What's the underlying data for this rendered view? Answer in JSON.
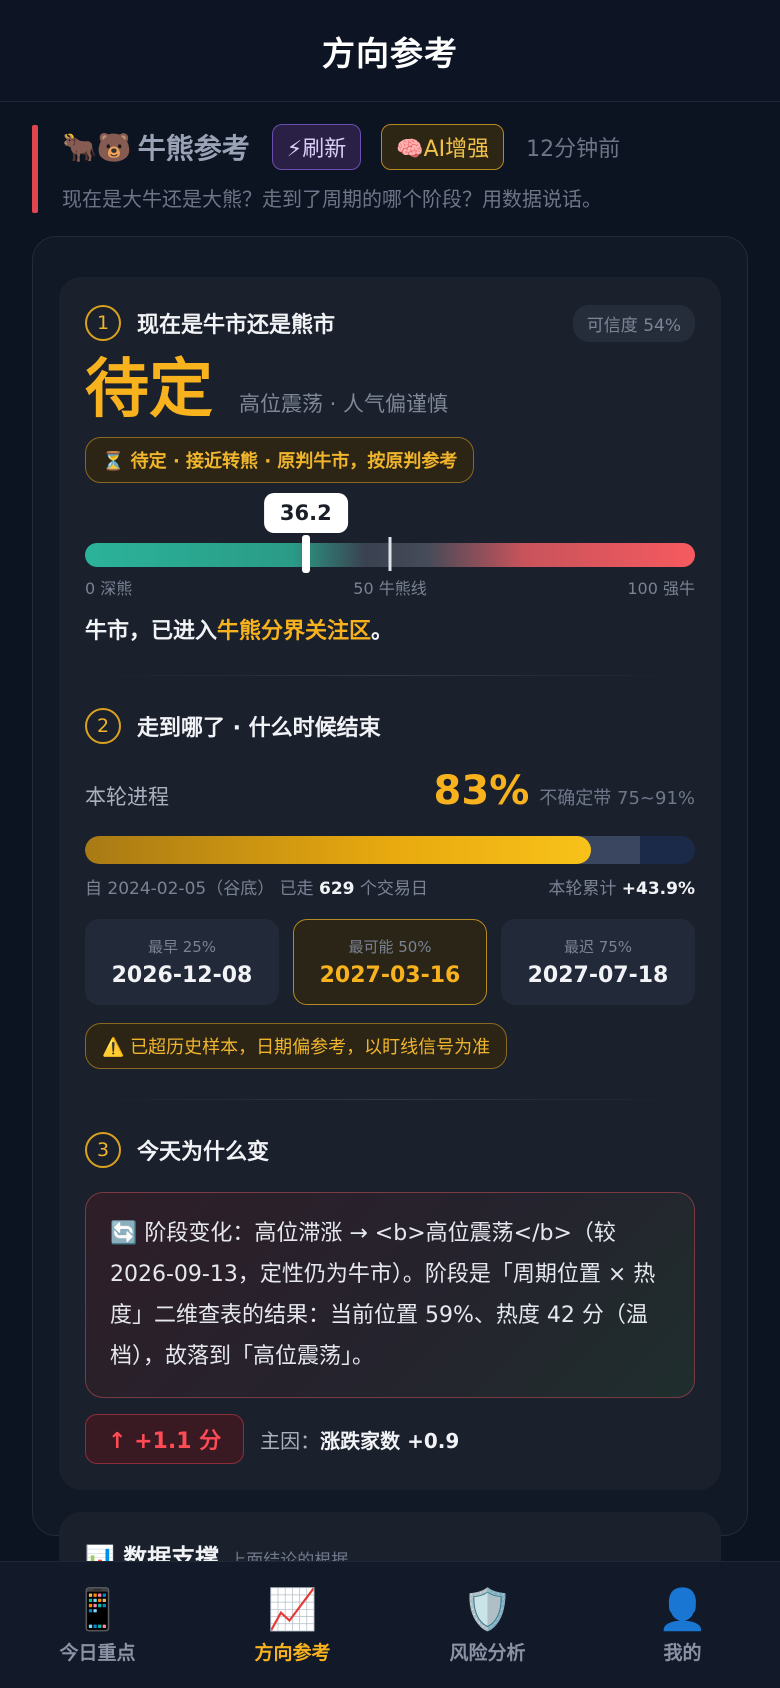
{
  "nav": {
    "title": "方向参考"
  },
  "header": {
    "emoji": "🐂🐻",
    "title": "牛熊参考",
    "refresh_label": "⚡刷新",
    "ai_label": "🧠AI增强",
    "time": "12分钟前",
    "subtitle": "现在是大牛还是大熊？走到了周期的哪个阶段？用数据说话。"
  },
  "q1": {
    "num": "1",
    "title": "现在是牛市还是熊市",
    "confidence": "可信度 54%",
    "verdict": "待定",
    "verdict_sub": "高位震荡 · 人气偏谨慎",
    "warn": "⏳ 待定 · 接近转熊 · 原判牛市，按原判参考",
    "gauge": {
      "value": 36.2,
      "value_label": "36.2",
      "min_label": "0 深熊",
      "mid_label": "50 牛熊线",
      "max_label": "100 强牛"
    },
    "conclusion_prefix": "牛市，已进入",
    "conclusion_highlight": "牛熊分界关注区",
    "conclusion_suffix": "。"
  },
  "q2": {
    "num": "2",
    "title": "走到哪了 · 什么时候结束",
    "progress_label": "本轮进程",
    "progress_pct": "83%",
    "progress_value": 83,
    "band_low": 75,
    "band_high": 91,
    "band_label": "不确定带 75~91%",
    "meta_start": "自 2024-02-05（谷底） 已走 ",
    "meta_days": "629",
    "meta_days_suffix": " 个交易日",
    "meta_gain_label": "本轮累计 ",
    "meta_gain": "+43.9%",
    "dates": [
      {
        "caption": "最早 25%",
        "value": "2026-12-08"
      },
      {
        "caption": "最可能 50%",
        "value": "2027-03-16"
      },
      {
        "caption": "最迟 75%",
        "value": "2027-07-18"
      }
    ],
    "note": "⚠️ 已超历史样本，日期偏参考，以盯线信号为准"
  },
  "q3": {
    "num": "3",
    "title": "今天为什么变",
    "reason": "🔄 阶段变化：高位滞涨 → <b>高位震荡</b>（较 2026-09-13，定性仍为牛市）。阶段是「周期位置 × 热度」二维查表的结果：当前位置 59%、热度 42 分（温档），故落到「高位震荡」。",
    "delta": "↑ +1.1 分",
    "cause_label": "主因：",
    "cause_value": "涨跌家数 +0.9"
  },
  "data_support": {
    "icon": "📊",
    "title": "数据支撑",
    "subtitle": "上面结论的根据"
  },
  "tabs": [
    {
      "icon": "📱",
      "label": "今日重点"
    },
    {
      "icon": "📈",
      "label": "方向参考"
    },
    {
      "icon": "🛡️",
      "label": "风险分析"
    },
    {
      "icon": "👤",
      "label": "我的"
    }
  ],
  "colors": {
    "accent": "#f7b21e",
    "bear_red": "#f55a5f",
    "bull_teal": "#2bb39a",
    "background": "#0c1321"
  }
}
